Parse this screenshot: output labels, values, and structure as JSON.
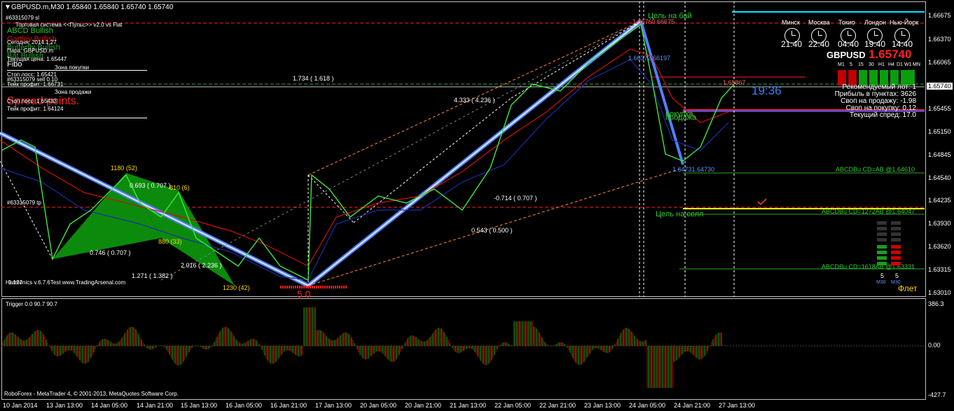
{
  "window": {
    "title": "GBPUSD.m,M30  1.65840 1.65840 1.65740 1.65740",
    "footer": "RoboForex - MetaTrader 4, © 2001-2013, MetaQuotes Software Corp.",
    "indicator_caption": "Trigger 0.0 90.7 90.7",
    "ticket_label": "#63315079 sl"
  },
  "info_panel": {
    "system_name": "Торговая система <<Пульс>> v2.0 vs Flat",
    "today": "Сегодня: 2014.1.27",
    "pair": "Пара:  GBPUSD.m",
    "current_price": "Текущая цена: 1.65447",
    "buy_zone": "Зона покупки",
    "stop_loss_buy": "Стоп лосс:     1.65421",
    "take_profit_buy": "Тейк профит:  1.66731",
    "sell_zone": "Зона продажи",
    "stop_loss_sell": "Стоп лосс:     1.65433",
    "take_profit_sell": "Тейк профит:  1.64124",
    "tp_label": "#63315079 tp",
    "sl_label2": "#63315079 sell 0.10",
    "patterns": [
      "ABCD Bullish",
      "Gartley Bullish",
      "Butterfly Bullish",
      "Bat Bullish"
    ],
    "fibo": "Fibo",
    "spread_points": "Spread points.",
    "harmonics_credit": "Harmonics v.6.7.6Test www.TradingArsenal.com"
  },
  "clocks": [
    {
      "city": "Минск",
      "time": "21:40"
    },
    {
      "city": "Москва",
      "time": "22:40"
    },
    {
      "city": "Токио",
      "time": "04:40"
    },
    {
      "city": "Лондон",
      "time": "19:40"
    },
    {
      "city": "Нью-Йорк",
      "time": "14:40"
    }
  ],
  "ticker": {
    "symbol": "GBPUSD",
    "price": "1.65740",
    "bar_timer": "19:36",
    "timeframes": [
      "M1",
      "5",
      "15",
      "30",
      "H1",
      "H4",
      "D1",
      "W1",
      "MN"
    ]
  },
  "stats": {
    "lot": "Рекомендуемый лот: 1",
    "profit_points": "Прибыль в пунктах: 3626",
    "swap_sell": "Своп на продажу: -1.98",
    "swap_buy": "Своп на покупку: 0.12",
    "spread": "Текущий спред: 17.0"
  },
  "signal_panel": {
    "labels": [
      "5",
      "5"
    ],
    "tf": [
      "M30",
      "M30"
    ],
    "mode": "Флет"
  },
  "annotations": {
    "target_buy": "Цель на бай",
    "target_sell": "Цель на селл",
    "buy_label": "покупка",
    "sell_label": "продажа",
    "level_abcd_1": "ABCDBu CD=AB  @1.64610",
    "level_abcd_2": "ABCDBu CD=1272AB  @1.64047",
    "level_abcd_3": "ABCDBu CD=1618AB  @1.63331",
    "top_price_label": "1.66760.66675",
    "mid_price_label": "1.66372.66197",
    "low_price_label": "1.64731.64730",
    "right_price_label": "1.65867",
    "fib_1": "1.734 ( 1.618 )",
    "fib_2": "4.333 ( 4.236 )",
    "fib_3": "-0.714 ( 0.707 )",
    "fib_4": "0.543 ( 0.500 )",
    "fib_5": "0.746 ( 0.707 )",
    "fib_6": "0.693 ( 0.707 )",
    "fib_7": "1.271 ( 1.382 )",
    "fib_8": "2.016 ( 2.236 )",
    "pt_1180": "1180 (52)",
    "pt_810": "810 (6)",
    "pt_880": "880 (33)",
    "pt_1230": "1230 (42)",
    "pt_5": "5.0",
    "label_1127": "1.127"
  },
  "price_axis": {
    "labels": [
      "1.66675",
      "1.66370",
      "1.66065",
      "1.65740",
      "1.65455",
      "1.65150",
      "1.64845",
      "1.64540",
      "1.64235",
      "1.63930",
      "1.63620",
      "1.63315",
      "1.63010"
    ],
    "current": "1.65740"
  },
  "indicator_axis": {
    "labels": [
      "386.3",
      "0.00",
      "-427.7"
    ]
  },
  "time_axis": {
    "labels": [
      "10 Jan 2014",
      "13 Jan 13:00",
      "14 Jan 05:00",
      "14 Jan 21:00",
      "15 Jan 13:00",
      "16 Jan 05:00",
      "16 Jan 21:00",
      "17 Jan 13:00",
      "20 Jan 05:00",
      "20 Jan 21:00",
      "21 Jan 13:00",
      "22 Jan 05:00",
      "22 Jan 21:00",
      "23 Jan 13:00",
      "24 Jan 05:00",
      "24 Jan 21:00",
      "27 Jan 13:00"
    ]
  }
}
